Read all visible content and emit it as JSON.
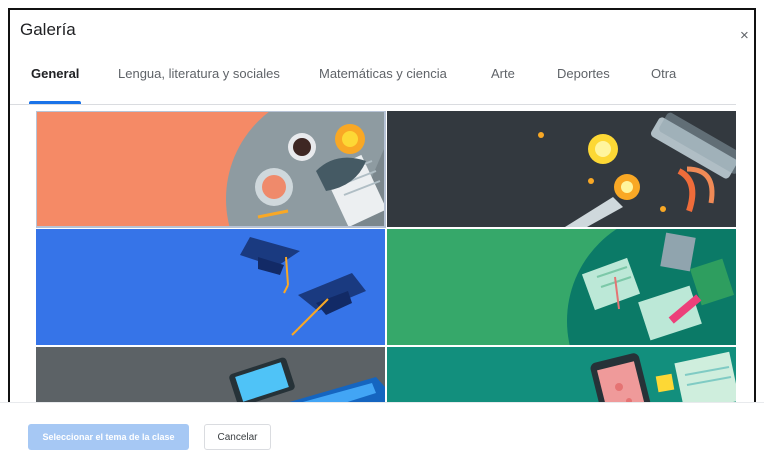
{
  "dialog": {
    "title": "Galería",
    "close_symbol": "×"
  },
  "tabs": [
    {
      "label": "General",
      "active": true
    },
    {
      "label": "Lengua, literatura y sociales",
      "active": false
    },
    {
      "label": "Matemáticas y ciencia",
      "active": false
    },
    {
      "label": "Arte",
      "active": false
    },
    {
      "label": "Deportes",
      "active": false
    },
    {
      "label": "Otra",
      "active": false
    }
  ],
  "themes": [
    {
      "name": "coffee-reading-theme",
      "color": "#f58a66",
      "selected": true
    },
    {
      "name": "lamp-diploma-theme",
      "color": "#33393f"
    },
    {
      "name": "graduation-caps-theme",
      "color": "#3674e8"
    },
    {
      "name": "books-theme",
      "color": "#36a86a"
    },
    {
      "name": "tablet-laptop-theme",
      "color": "#5c6266"
    },
    {
      "name": "phone-notes-theme",
      "color": "#128f7d"
    }
  ],
  "footer": {
    "select_label": "Seleccionar el tema de la clase",
    "cancel_label": "Cancelar"
  },
  "colors": {
    "accent": "#1a73e8",
    "primary_disabled": "#a6c8f4"
  }
}
